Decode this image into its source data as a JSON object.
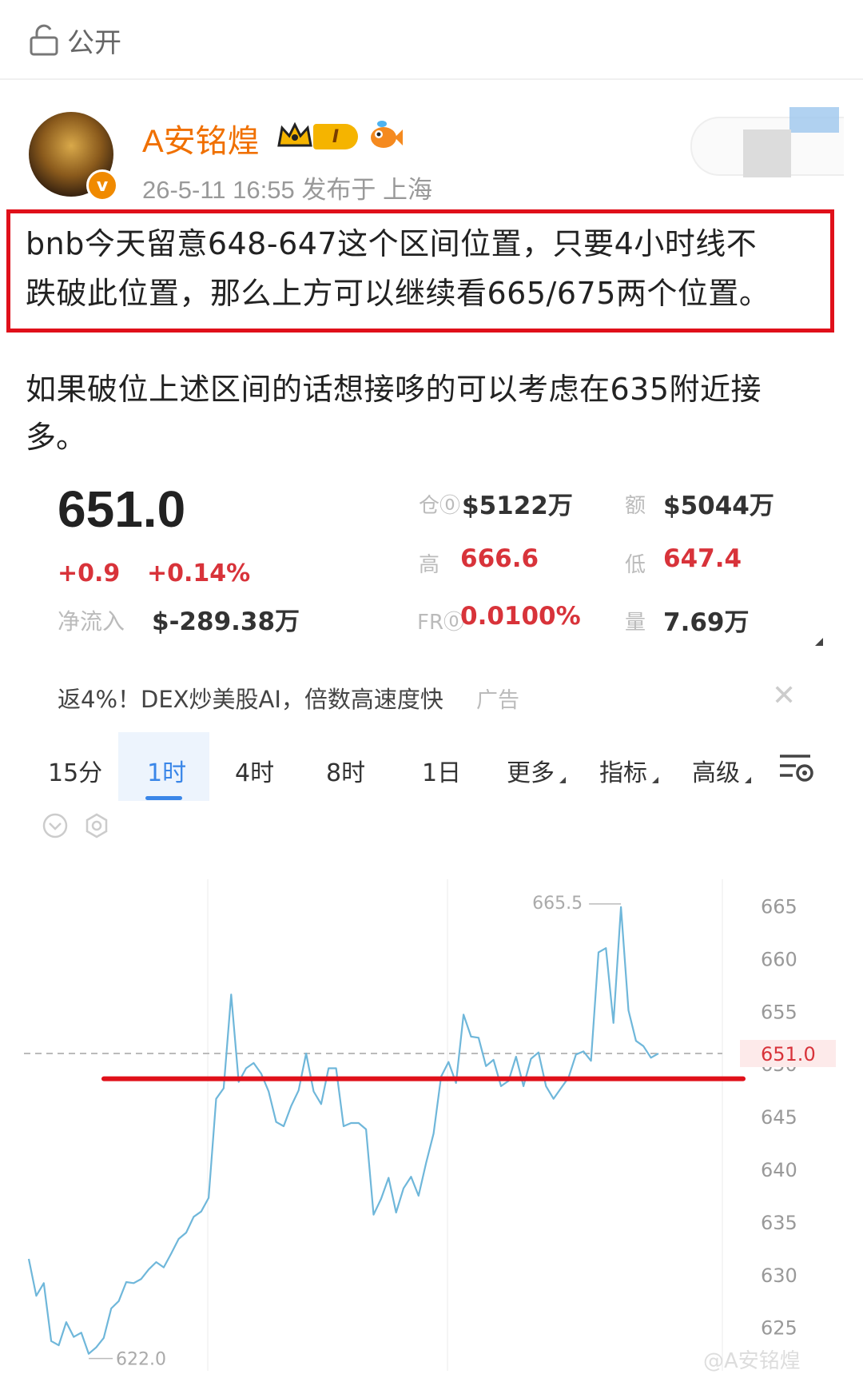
{
  "topbar": {
    "visibility_label": "公开",
    "icon": "lock-icon"
  },
  "profile": {
    "username": "A安铭煌",
    "level_badge": "I",
    "verified_badge": "v",
    "post_meta": "26-5-11 16:55   发布于 上海"
  },
  "post": {
    "line1": "bnb今天留意648-647这个区间位置，只要4小时线不",
    "line2": "跌破此位置，那么上方可以继续看665/675两个位置。",
    "line3": "如果破位上述区间的话想接哆的可以考虑在635附近接",
    "line4": "多。"
  },
  "ticker": {
    "price": "651.0",
    "change_abs": "+0.9",
    "change_pct": "+0.14%",
    "netflow_label": "净流入",
    "netflow_value": "$-289.38万",
    "open_interest_label": "仓⓪",
    "open_interest_value": "$5122万",
    "turnover_label": "额",
    "turnover_value": "$5044万",
    "high_label": "高",
    "high_value": "666.6",
    "low_label": "低",
    "low_value": "647.4",
    "funding_label": "FR⓪",
    "funding_value": "0.0100%",
    "volume_label": "量",
    "volume_value": "7.69万"
  },
  "ad": {
    "text": "返4%！DEX炒美股AI，倍数高速度快",
    "tag": "广告",
    "close": "✕"
  },
  "tabs": {
    "t15m": "15分",
    "t1h": "1时",
    "t4h": "4时",
    "t8h": "8时",
    "t1d": "1日",
    "more": "更多",
    "indicators": "指标",
    "advanced": "高级"
  },
  "watermark": "@A安铭煌",
  "colors": {
    "accent_red": "#d8333a",
    "line_blue": "#6fb7da",
    "highlight_red": "#e0101a",
    "username_orange": "#f07000"
  },
  "chart_data": {
    "type": "line",
    "title": "",
    "xlabel": "",
    "ylabel": "",
    "ylim": [
      621,
      667
    ],
    "y_ticks": [
      "665",
      "660",
      "655",
      "650",
      "645",
      "640",
      "635",
      "630",
      "625"
    ],
    "max_label": "665.5",
    "min_label": "622.0",
    "current_label": "651.0",
    "current_value": 651.0,
    "support_line_value": 648.6,
    "series": [
      {
        "values": [
          631.5,
          628,
          629.2,
          623.7,
          623.3,
          625.5,
          624.1,
          624.5,
          622.5,
          623.1,
          624,
          626.8,
          627.5,
          629.3,
          629.2,
          629.6,
          630.5,
          631.2,
          630.7,
          632,
          633.4,
          634,
          635.5,
          636,
          637.3,
          646.7,
          647.7,
          656.6,
          648.3,
          649.6,
          650.1,
          649.1,
          647.4,
          644.5,
          644.1,
          646,
          647.5,
          651,
          647.4,
          646.2,
          649.6,
          649.6,
          644.1,
          644.4,
          644.4,
          643.8,
          635.7,
          637.2,
          639.2,
          635.9,
          638.2,
          639.3,
          637.5,
          640.6,
          643.4,
          648.8,
          650.2,
          648.2,
          654.7,
          652.6,
          652.5,
          649.8,
          650.4,
          647.9,
          648.4,
          650.7,
          647.9,
          650.5,
          651.1,
          647.9,
          646.7,
          647.7,
          648.7,
          650.9,
          651.2,
          650.3,
          660.6,
          661,
          653.9,
          664.9,
          655.1,
          652.2,
          651.7,
          650.6,
          651
        ]
      }
    ]
  }
}
